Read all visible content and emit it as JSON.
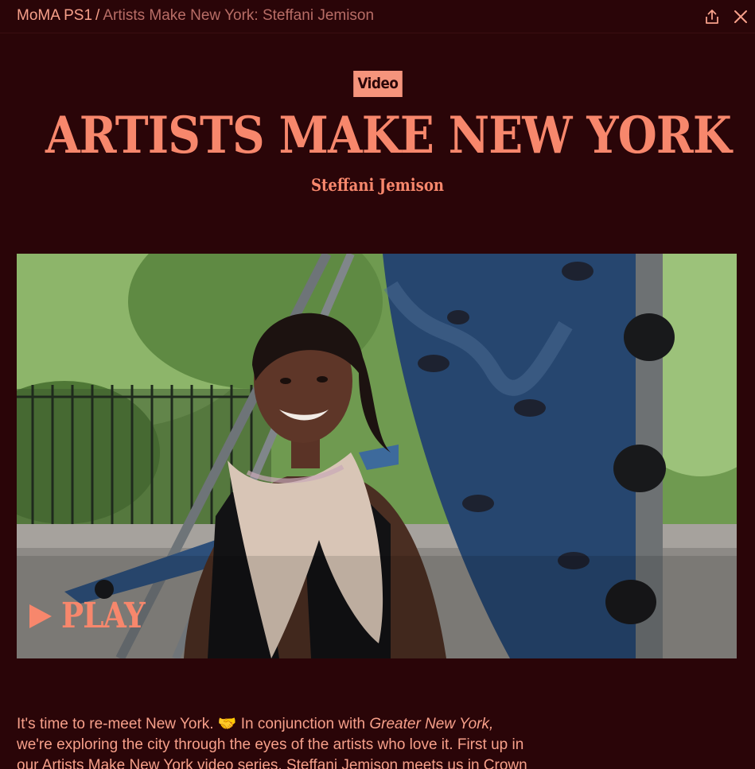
{
  "breadcrumb": {
    "site": "MoMA PS1",
    "separator": "/",
    "page": "Artists Make New York: Steffani Jemison"
  },
  "toolbar": {
    "share_icon": "share-icon",
    "close_icon": "close-icon"
  },
  "header": {
    "badge": "Video",
    "title": "ARTISTS MAKE NEW YORK",
    "subtitle": "Steffani Jemison"
  },
  "video": {
    "play_label": "PLAY",
    "play_icon": "play-icon"
  },
  "description": {
    "line1_start": "It's time to re-meet New York. 🤝 In conjunction with ",
    "line1_italic": "Greater New York,",
    "line2": "we're exploring the city through the eyes of the artists who love it. First up in",
    "line3": "our Artists Make New York video series, Steffani Jemison meets us in Crown"
  },
  "colors": {
    "background": "#2a0508",
    "accent": "#f5947c"
  }
}
